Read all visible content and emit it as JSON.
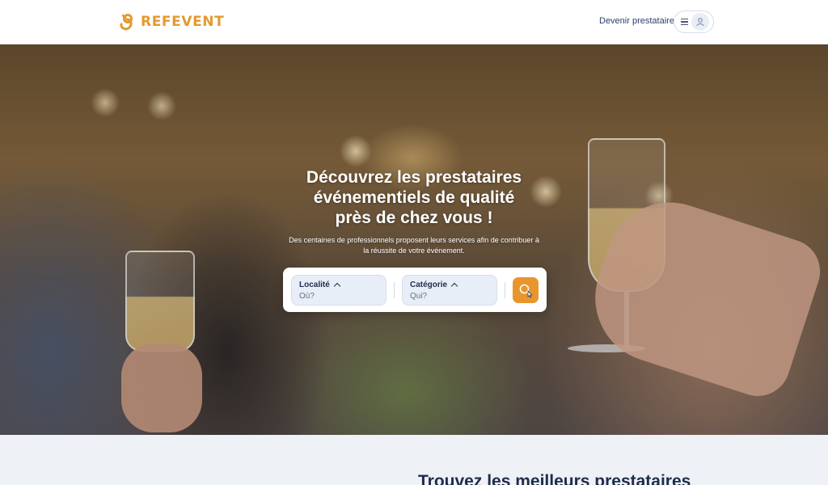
{
  "header": {
    "brand": "REFEVENT",
    "become_provider": "Devenir prestataire"
  },
  "icons": {
    "logo": "refevent-logo-icon",
    "menu": "hamburger-icon",
    "user": "user-icon",
    "search": "search-icon",
    "cursor": "pointer-cursor-icon"
  },
  "hero": {
    "title_line1": "Découvrez les prestataires",
    "title_line2": "événementiels de qualité",
    "title_line3": "près de chez vous !",
    "subtitle_line1": "Des centaines de professionnels proposent leurs services afin de contribuer à",
    "subtitle_line2": "la réussite de votre événement."
  },
  "search": {
    "location_label": "Localité",
    "location_placeholder": "Où?",
    "category_label": "Catégorie",
    "category_placeholder": "Qui?"
  },
  "section": {
    "title": "Trouvez les meilleurs prestataires"
  },
  "colors": {
    "accent": "#e8952d",
    "navy": "#1f2d4a",
    "field_bg": "#e8eef7",
    "section_bg": "#eef1f6"
  }
}
